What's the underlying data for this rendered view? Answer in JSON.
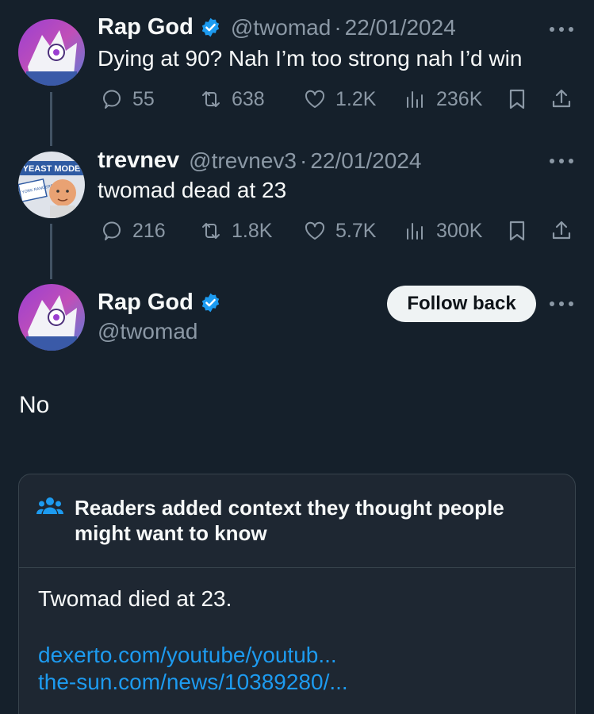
{
  "colors": {
    "background": "#15202b",
    "text": "#f7f9f9",
    "muted": "#8b98a5",
    "verified": "#1d9bf0",
    "link": "#1d9bf0",
    "follow_button_bg": "#eff3f4"
  },
  "reply1": {
    "name": "Rap God",
    "handle": "@twomad",
    "separator": "·",
    "date": "22/01/2024",
    "text": "Dying at 90? Nah I’m too strong nah I’d win",
    "replies": "55",
    "reposts": "638",
    "likes": "1.2K",
    "views": "236K"
  },
  "reply2": {
    "name": "trevnev",
    "handle": "@trevnev3",
    "separator": "·",
    "date": "22/01/2024",
    "text": "twomad dead at 23",
    "replies": "216",
    "reposts": "1.8K",
    "likes": "5.7K",
    "views": "300K",
    "avatar_text_top": "YEAST MODE",
    "avatar_text_bottom": "NEW YORK RANGERS"
  },
  "main": {
    "name": "Rap God",
    "handle": "@twomad",
    "follow_label": "Follow back",
    "text": "No"
  },
  "note": {
    "title": "Readers added context they thought people might want to know",
    "body": "Twomad died at 23.",
    "links": [
      "dexerto.com/youtube/youtub...",
      "the-sun.com/news/10389280/..."
    ]
  }
}
